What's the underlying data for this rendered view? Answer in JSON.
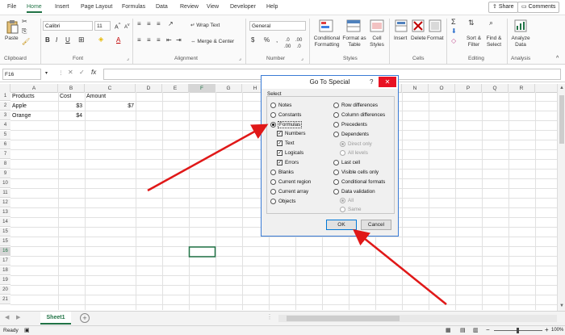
{
  "menu_tabs": [
    "File",
    "Home",
    "Insert",
    "Page Layout",
    "Formulas",
    "Data",
    "Review",
    "View",
    "Developer",
    "Help"
  ],
  "share": "Share",
  "comments": "Comments",
  "ribbon": {
    "paste": "Paste",
    "clipboard": "Clipboard",
    "font_name": "Calibri",
    "font_size": "11",
    "font": "Font",
    "wrap_text": "Wrap Text",
    "merge_center": "Merge & Center",
    "alignment": "Alignment",
    "number_format": "General",
    "number": "Number",
    "conditional_formatting": "Conditional Formatting",
    "format_as_table": "Format as Table",
    "cell_styles": "Cell Styles",
    "styles": "Styles",
    "insert": "Insert",
    "delete": "Delete",
    "format": "Format",
    "cells": "Cells",
    "sort_filter": "Sort & Filter",
    "find_select": "Find & Select",
    "editing": "Editing",
    "analyze_data": "Analyze Data",
    "analysis": "Analysis",
    "bold": "B",
    "italic": "I",
    "underline": "U"
  },
  "name_box": "F16",
  "fx": "fx",
  "columns": [
    "A",
    "B",
    "C",
    "D",
    "E",
    "F",
    "G",
    "H",
    "I",
    "J",
    "K",
    "L",
    "M",
    "N",
    "O",
    "P",
    "Q",
    "R"
  ],
  "rows": [
    "1",
    "2",
    "3",
    "4",
    "5",
    "6",
    "7",
    "8",
    "9",
    "10",
    "11",
    "12",
    "13",
    "14",
    "15",
    "16",
    "17",
    "18",
    "19",
    "20",
    "21",
    "22"
  ],
  "cells": {
    "a1": "Products",
    "b1": "Cost",
    "c1": "Amount",
    "a2": "Apple",
    "b2": "$3",
    "c2": "$7",
    "a3": "Orange",
    "b3": "$4"
  },
  "sheet_tab": "Sheet1",
  "status": "Ready",
  "zoom": "100%",
  "dialog": {
    "title": "Go To Special",
    "help": "?",
    "close": "✕",
    "select_label": "Select",
    "left_options": [
      "Notes",
      "Constants",
      "Formulas",
      "Numbers",
      "Text",
      "Logicals",
      "Errors",
      "Blanks",
      "Current region",
      "Current array",
      "Objects"
    ],
    "right_options": [
      "Row differences",
      "Column differences",
      "Precedents",
      "Dependents",
      "Direct only",
      "All levels",
      "Last cell",
      "Visible cells only",
      "Conditional formats",
      "Data validation",
      "All",
      "Same"
    ],
    "ok": "OK",
    "cancel": "Cancel"
  }
}
